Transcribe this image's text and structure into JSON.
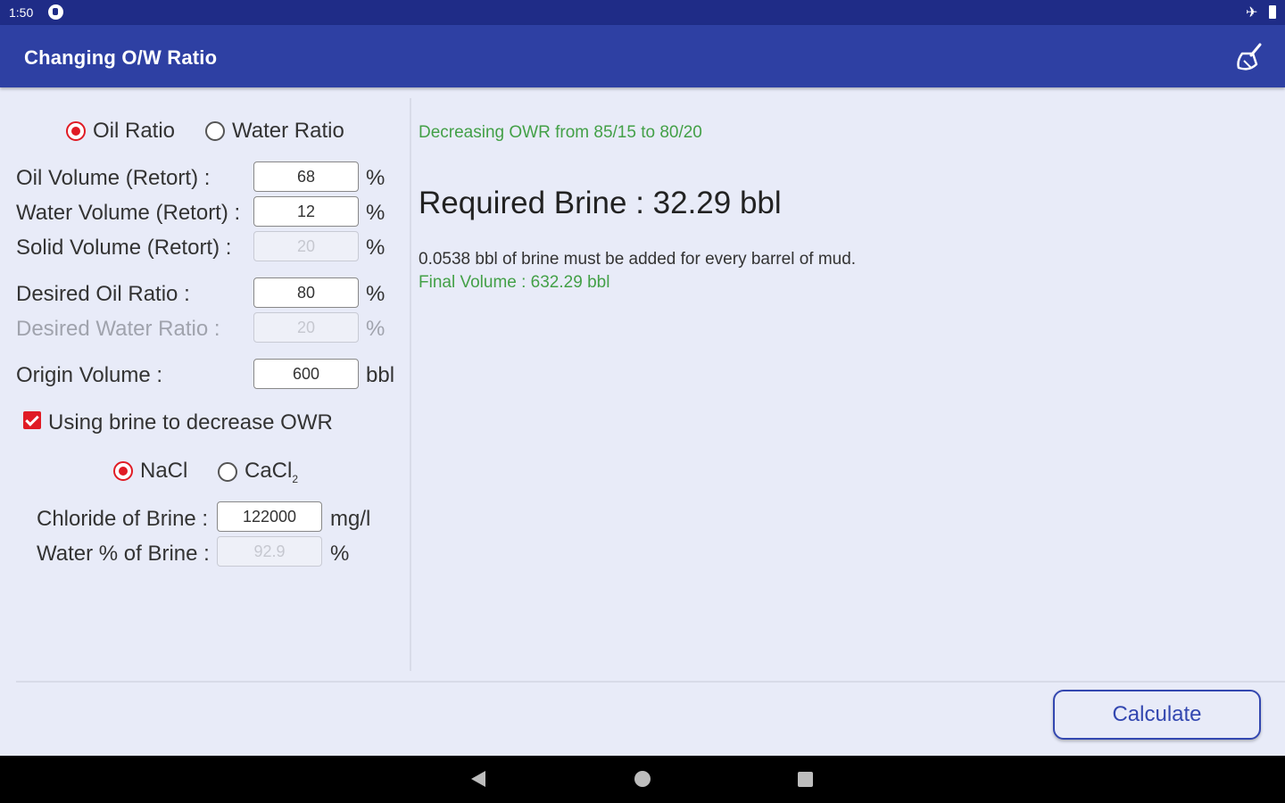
{
  "status_bar": {
    "time": "1:50"
  },
  "app_bar": {
    "title": "Changing O/W Ratio",
    "action_icon": "broom-clear-icon"
  },
  "ratio_mode": {
    "options": [
      "Oil Ratio",
      "Water Ratio"
    ],
    "selected": "Oil Ratio"
  },
  "inputs": {
    "oil_volume": {
      "label": "Oil Volume (Retort) :",
      "value": "68",
      "unit": "%"
    },
    "water_volume": {
      "label": "Water Volume (Retort) :",
      "value": "12",
      "unit": "%"
    },
    "solid_volume": {
      "label": "Solid Volume (Retort) :",
      "value": "20",
      "unit": "%"
    },
    "desired_oil": {
      "label": "Desired Oil Ratio :",
      "value": "80",
      "unit": "%"
    },
    "desired_water": {
      "label": "Desired Water Ratio :",
      "value": "20",
      "unit": "%"
    },
    "origin_volume": {
      "label": "Origin Volume :",
      "value": "600",
      "unit": "bbl"
    }
  },
  "brine": {
    "checkbox_label": "Using brine to decrease OWR",
    "checked": true,
    "salt_options": {
      "nacl": "NaCl",
      "cacl_base": "CaCl",
      "cacl_sub": "2"
    },
    "selected_salt": "NaCl",
    "chloride": {
      "label": "Chloride of Brine :",
      "value": "122000",
      "unit": "mg/l"
    },
    "water_pct": {
      "label": "Water % of Brine :",
      "value": "92.9",
      "unit": "%"
    }
  },
  "results": {
    "heading": "Decreasing OWR from 85/15 to 80/20",
    "required": "Required Brine : 32.29 bbl",
    "per_barrel": "0.0538 bbl of brine must be added for every barrel of mud.",
    "final_volume": "Final Volume : 632.29 bbl"
  },
  "actions": {
    "calculate": "Calculate"
  },
  "colors": {
    "appbar": "#2e40a3",
    "statusbar": "#1f2c87",
    "accent_red": "#e01b24",
    "result_green": "#43a047",
    "button_blue": "#3347b0"
  }
}
